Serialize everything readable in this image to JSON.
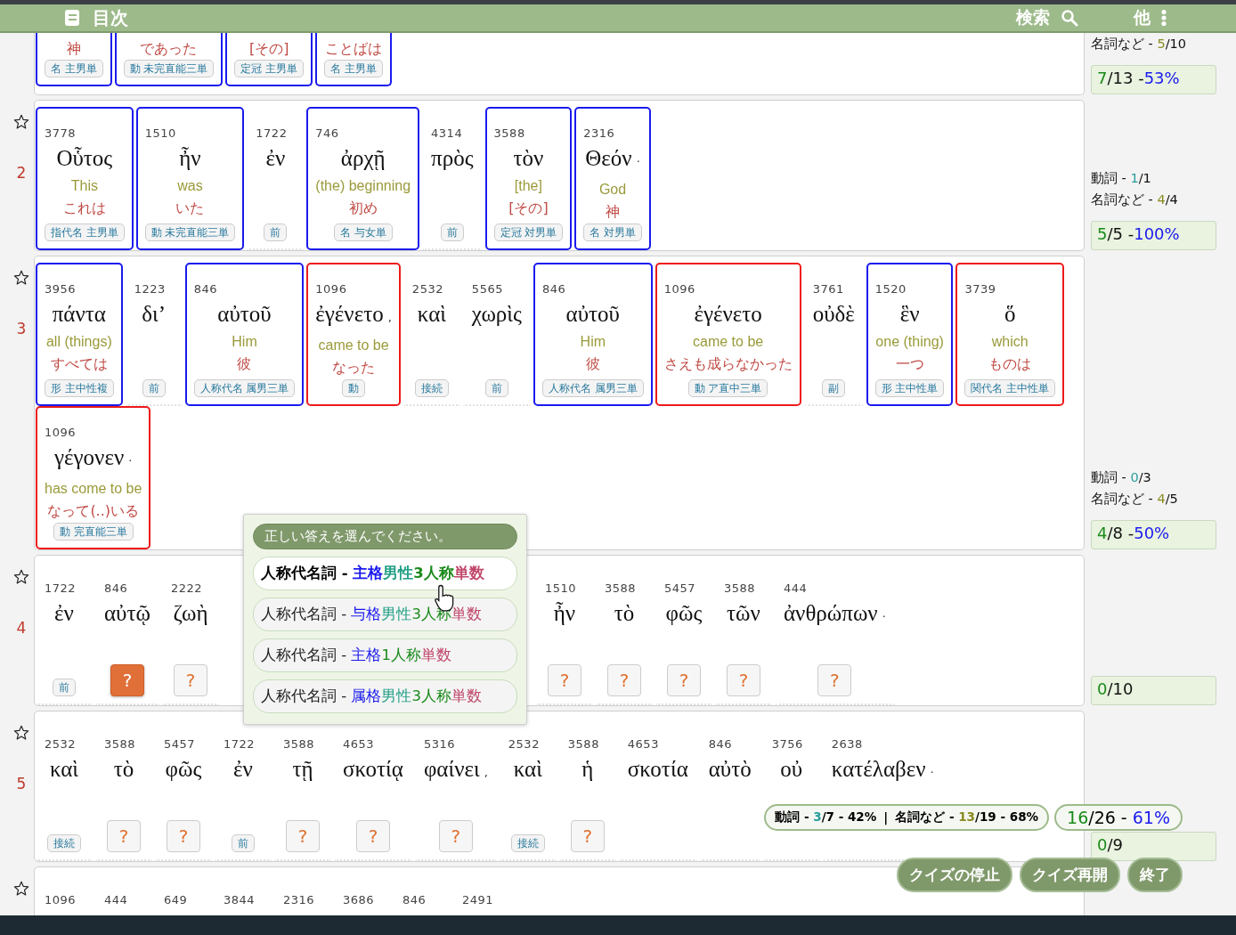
{
  "header": {
    "toc": "目次",
    "search": "検索",
    "more": "他"
  },
  "verses": [
    {
      "lines": [
        [
          {
            "jp": "神",
            "tag": "名 主男単",
            "color": "#1a1aee"
          },
          {
            "jp": "であった",
            "tag": "動 未完直能三単",
            "color": "#1a1aee"
          },
          {
            "jp": "[その]",
            "tag": "定冠 主男単",
            "color": "#1a1aee"
          },
          {
            "jp": "ことばは",
            "tag": "名 主男単",
            "color": "#1a1aee"
          }
        ]
      ],
      "stats": [
        {
          "kind": "noun",
          "label": "名詞など -",
          "got": "5",
          "rest": "/10"
        }
      ],
      "score": {
        "got": "7",
        "rest": "/13 -",
        "percent": "53%"
      }
    },
    {
      "number": "2",
      "lines": [
        [
          {
            "number": "3778",
            "greek": "Οὗτος",
            "en": "This",
            "jp": "これは",
            "tag": "指代名 主男単",
            "color": "#1a1aee"
          },
          {
            "number": "1510",
            "greek": "ἦν",
            "en": "was",
            "jp": "いた",
            "tag": "動 未完直能三単",
            "color": "#1a1aee"
          },
          {
            "number": "1722",
            "greek": "ἐν",
            "tag": "前"
          },
          {
            "number": "746",
            "greek": "ἀρχῇ",
            "en": "(the) beginning",
            "jp": "初め",
            "tag": "名 与女単",
            "color": "#1a1aee"
          },
          {
            "number": "4314",
            "greek": "πρὸς",
            "tag": "前"
          },
          {
            "number": "3588",
            "greek": "τὸν",
            "en": "[the]",
            "jp": "[その]",
            "tag": "定冠 対男単",
            "color": "#1a1aee"
          },
          {
            "number": "2316",
            "greek": "Θεόν",
            "punct": "·",
            "en": "God",
            "jp": "神",
            "tag": "名 対男単",
            "color": "#1a1aee"
          }
        ]
      ],
      "stats": [
        {
          "kind": "verb",
          "label": "動詞 -",
          "got": "1",
          "rest": "/1"
        },
        {
          "kind": "noun",
          "label": "名詞など -",
          "got": "4",
          "rest": "/4"
        }
      ],
      "score": {
        "got": "5",
        "rest": "/5 -",
        "percent": "100%"
      }
    },
    {
      "number": "3",
      "lines": [
        [
          {
            "number": "3956",
            "greek": "πάντα",
            "en": "all (things)",
            "jp": "すべては",
            "tag": "形 主中性複",
            "color": "#1a1aee"
          },
          {
            "number": "1223",
            "greek": "δι’",
            "tag": "前"
          },
          {
            "number": "846",
            "greek": "αὐτοῦ",
            "en": "Him",
            "jp": "彼",
            "tag": "人称代名 属男三単",
            "color": "#1a1aee"
          },
          {
            "number": "1096",
            "greek": "ἐγένετο",
            "punct": ",",
            "en": "came to be",
            "jp": "なった",
            "tag": "動",
            "color": "#ee1a1a"
          },
          {
            "number": "2532",
            "greek": "καὶ",
            "tag": "接続"
          },
          {
            "number": "5565",
            "greek": "χωρὶς",
            "tag": "前"
          },
          {
            "number": "846",
            "greek": "αὐτοῦ",
            "en": "Him",
            "jp": "彼",
            "tag": "人称代名 属男三単",
            "color": "#1a1aee"
          },
          {
            "number": "1096",
            "greek": "ἐγένετο",
            "en": "came to be",
            "jp": "さえも成らなかった",
            "tag": "動 ア直中三単",
            "color": "#ee1a1a"
          },
          {
            "number": "3761",
            "greek": "οὐδὲ",
            "tag": "副"
          },
          {
            "number": "1520",
            "greek": "ἓν",
            "en": "one (thing)",
            "jp": "一つ",
            "tag": "形 主中性単",
            "color": "#1a1aee"
          },
          {
            "number": "3739",
            "greek": "ὅ",
            "en": "which",
            "jp": "ものは",
            "tag": "関代名 主中性単",
            "color": "#ee1a1a"
          }
        ],
        [
          {
            "number": "1096",
            "greek": "γέγονεν",
            "punct": "·",
            "en": "has come to be",
            "jp": "なって(..)いる",
            "tag": "動 完直能三単",
            "color": "#ee1a1a"
          }
        ]
      ],
      "stats": [
        {
          "kind": "verb",
          "label": "動詞 -",
          "got": "0",
          "rest": "/3"
        },
        {
          "kind": "noun",
          "label": "名詞など -",
          "got": "4",
          "rest": "/5"
        }
      ],
      "score": {
        "got": "4",
        "rest": "/8 -",
        "percent": "50%"
      }
    },
    {
      "number": "4",
      "lines": [
        [
          {
            "number": "1722",
            "greek": "ἐν",
            "tag": "前"
          },
          {
            "number": "846",
            "greek": "αὐτῷ",
            "quiz": {
              "label": "?",
              "selected": true
            }
          },
          {
            "number": "2222",
            "greek": "ζωὴ",
            "quiz": {
              "label": "?",
              "selected": false
            }
          },
          {
            "number": "1510",
            "greek": "ἦν",
            "quiz": {
              "label": "?",
              "selected": false
            }
          },
          {
            "number": "3588",
            "greek": "τὸ",
            "quiz": {
              "label": "?",
              "selected": false
            }
          },
          {
            "number": "5457",
            "greek": "φῶς",
            "quiz": {
              "label": "?",
              "selected": false
            }
          },
          {
            "number": "3588",
            "greek": "τῶν",
            "quiz": {
              "label": "?",
              "selected": false
            }
          },
          {
            "number": "444",
            "greek": "ἀνθρώπων",
            "punct": "·",
            "quiz": {
              "label": "?",
              "selected": false
            }
          }
        ]
      ],
      "score": {
        "got": "0",
        "rest": "/10"
      }
    },
    {
      "number": "5",
      "lines": [
        [
          {
            "number": "2532",
            "greek": "καὶ",
            "tag": "接続"
          },
          {
            "number": "3588",
            "greek": "τὸ",
            "quiz": {
              "label": "?",
              "selected": false
            }
          },
          {
            "number": "5457",
            "greek": "φῶς",
            "quiz": {
              "label": "?",
              "selected": false
            }
          },
          {
            "number": "1722",
            "greek": "ἐν",
            "tag": "前"
          },
          {
            "number": "3588",
            "greek": "τῇ",
            "quiz": {
              "label": "?",
              "selected": false
            }
          },
          {
            "number": "4653",
            "greek": "σκοτίᾳ",
            "quiz": {
              "label": "?",
              "selected": false
            }
          },
          {
            "number": "5316",
            "greek": "φαίνει",
            "punct": ",",
            "quiz": {
              "label": "?",
              "selected": false
            }
          },
          {
            "number": "2532",
            "greek": "καὶ",
            "tag": "接続"
          },
          {
            "number": "3588",
            "greek": "ἡ",
            "quiz": {
              "label": "?",
              "selected": false
            }
          },
          {
            "number": "4653",
            "greek": "σκοτία"
          },
          {
            "number": "846",
            "greek": "αὐτὸ"
          },
          {
            "number": "3756",
            "greek": "οὐ"
          },
          {
            "number": "2638",
            "greek": "κατέλαβεν",
            "punct": "·"
          }
        ]
      ],
      "score": {
        "got": "0",
        "rest": "/9"
      }
    },
    {
      "lines": [
        [
          {
            "number": "1096"
          },
          {
            "number": "444"
          },
          {
            "number": "649"
          },
          {
            "number": "3844"
          },
          {
            "number": "2316"
          },
          {
            "number": "3686"
          },
          {
            "number": "846"
          },
          {
            "number": "2491"
          }
        ]
      ]
    }
  ],
  "quiz_popup": {
    "prompt": "正しい答えを選んでください。",
    "options": [
      {
        "pos": "人称代名詞 -",
        "parts": [
          {
            "kind": "case",
            "text": "主格"
          },
          {
            "kind": "gender",
            "text": "男性"
          },
          {
            "kind": "person",
            "text": "3人称"
          },
          {
            "kind": "number",
            "text": "単数"
          }
        ],
        "selected": true
      },
      {
        "pos": "人称代名詞 -",
        "parts": [
          {
            "kind": "case",
            "text": "与格"
          },
          {
            "kind": "gender",
            "text": "男性"
          },
          {
            "kind": "person",
            "text": "3人称"
          },
          {
            "kind": "number",
            "text": "単数"
          }
        ],
        "selected": false
      },
      {
        "pos": "人称代名詞 -",
        "parts": [
          {
            "kind": "case",
            "text": "主格"
          },
          {
            "kind": "person",
            "text": "1人称"
          },
          {
            "kind": "number",
            "text": "単数"
          }
        ],
        "selected": false
      },
      {
        "pos": "人称代名詞 -",
        "parts": [
          {
            "kind": "case",
            "text": "属格"
          },
          {
            "kind": "gender",
            "text": "男性"
          },
          {
            "kind": "person",
            "text": "3人称"
          },
          {
            "kind": "number",
            "text": "単数"
          }
        ],
        "selected": false
      }
    ]
  },
  "summary": {
    "groups": [
      {
        "kind": "verb",
        "label": "動詞 -",
        "got": "3",
        "rest": "/7 - 42%"
      },
      {
        "kind": "noun",
        "label": "名詞など -",
        "got": "13",
        "rest": "/19 - 68%"
      }
    ],
    "separator": "|"
  },
  "total": {
    "got": "16",
    "rest": "/26 -",
    "percent": "61%"
  },
  "buttons": [
    "クイズの停止",
    "クイズ再開",
    "終了"
  ]
}
